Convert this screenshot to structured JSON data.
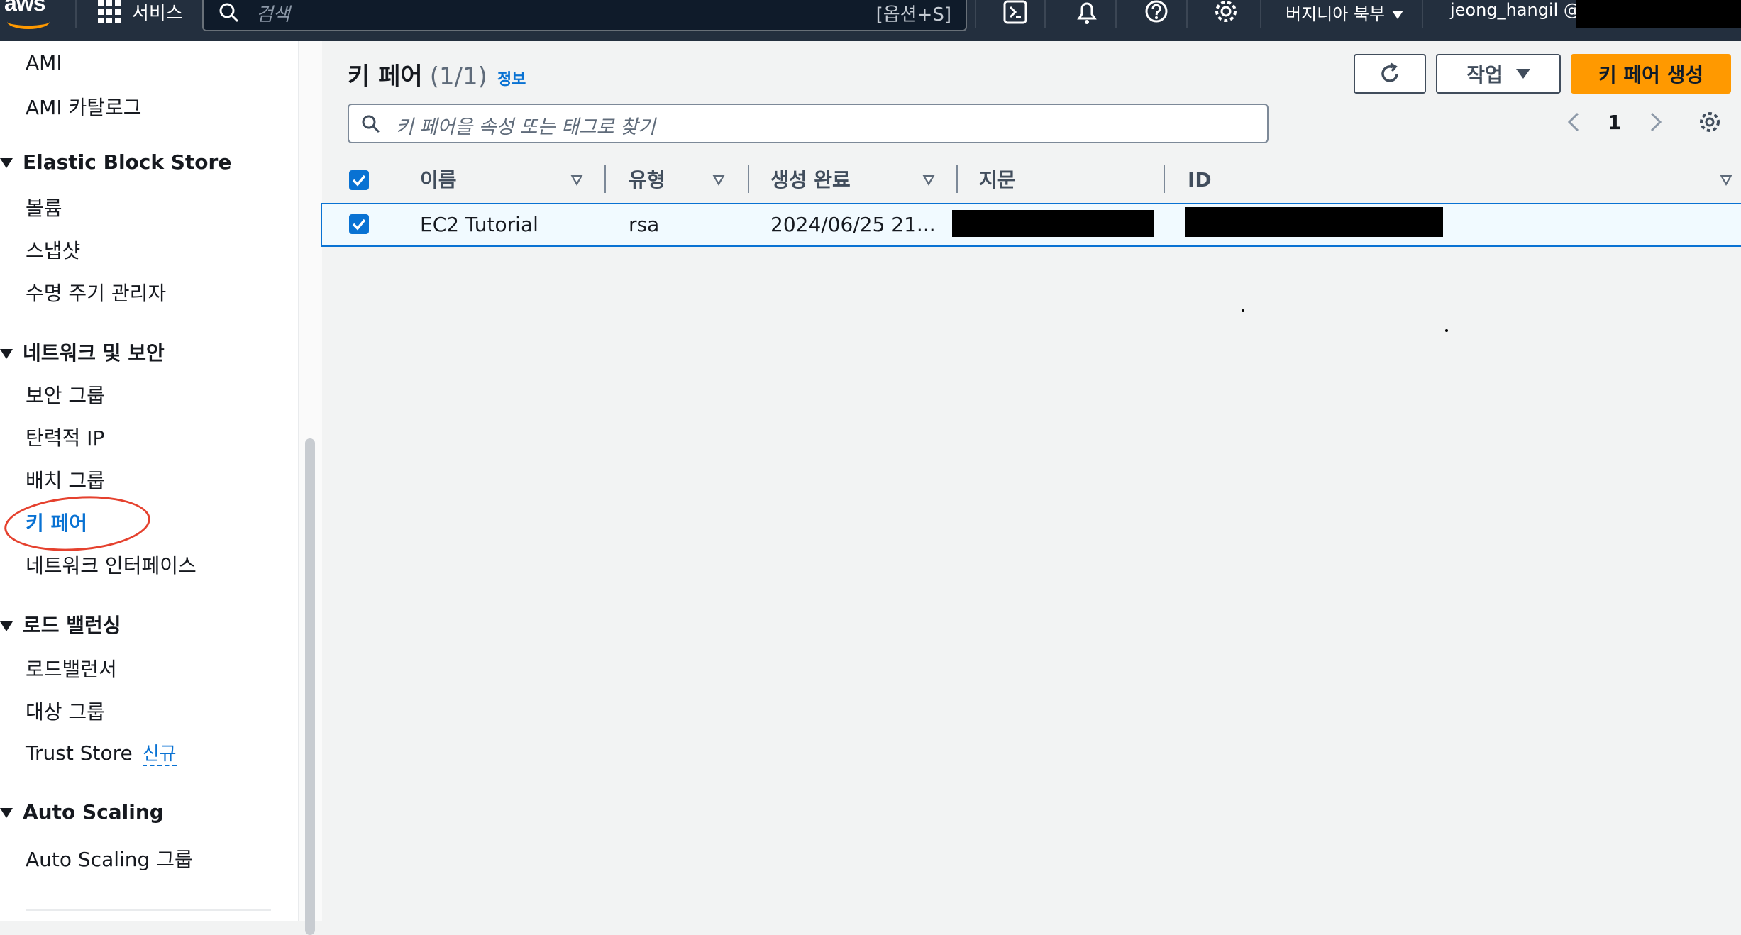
{
  "topnav": {
    "logo": "aws",
    "services_label": "서비스",
    "search_placeholder": "검색",
    "search_shortcut": "[옵션+S]",
    "region": "버지니아 북부",
    "user": "jeong_hangil @"
  },
  "sidebar": {
    "items_top": [
      "AMI",
      "AMI 카탈로그"
    ],
    "sections": [
      {
        "title": "Elastic Block Store",
        "items": [
          "볼륨",
          "스냅샷",
          "수명 주기 관리자"
        ]
      },
      {
        "title": "네트워크 및 보안",
        "items": [
          "보안 그룹",
          "탄력적 IP",
          "배치 그룹",
          "키 페어",
          "네트워크 인터페이스"
        ]
      },
      {
        "title": "로드 밸런싱",
        "items": [
          "로드밸런서",
          "대상 그룹",
          "Trust Store"
        ]
      },
      {
        "title": "Auto Scaling",
        "items": [
          "Auto Scaling 그룹"
        ]
      }
    ],
    "new_badge": "신규",
    "active_item": "키 페어"
  },
  "main": {
    "title": "키 페어",
    "count": "(1/1)",
    "info_link": "정보",
    "actions_label": "작업",
    "create_label": "키 페어 생성",
    "filter_placeholder": "키 페어을 속성 또는 태그로 찾기",
    "page_number": "1",
    "columns": [
      "이름",
      "유형",
      "생성 완료",
      "지문",
      "ID"
    ],
    "rows": [
      {
        "name": "EC2 Tutorial",
        "type": "rsa",
        "created": "2024/06/25 21...",
        "fingerprint": "",
        "id": ""
      }
    ]
  },
  "colors": {
    "nav_bg": "#232f3e",
    "accent_orange": "#ff9900",
    "link_blue": "#0972d3",
    "annotation_red": "#e5412e"
  }
}
